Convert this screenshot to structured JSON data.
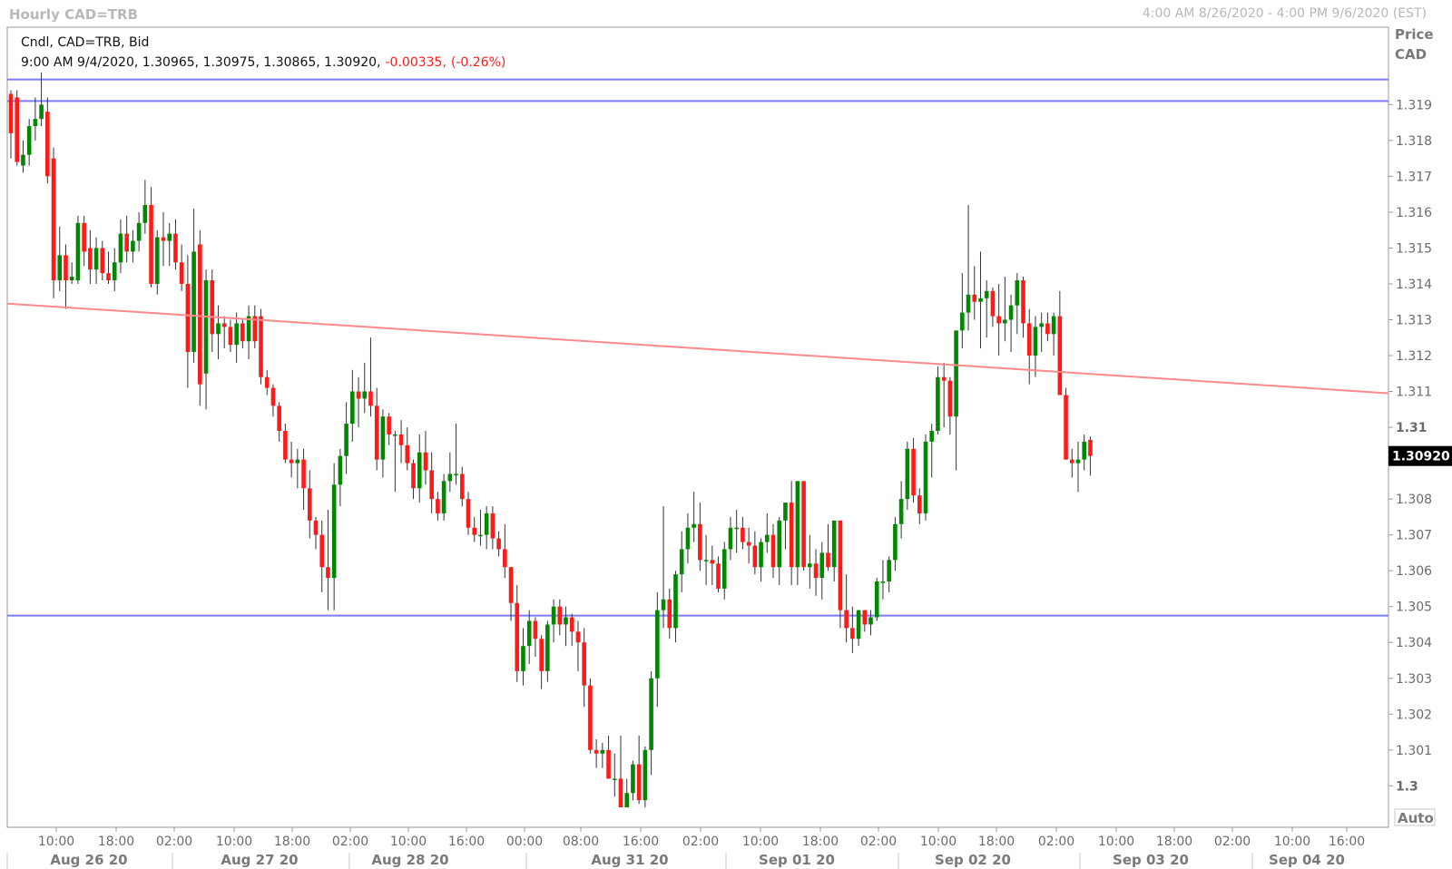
{
  "window": {
    "title": "Hourly CAD=TRB",
    "range": "4:00 AM 8/26/2020 - 4:00 PM 9/6/2020 (EST)"
  },
  "legend": {
    "series_label": "Cndl, CAD=TRB, Bid",
    "ohlc_text": "9:00 AM 9/4/2020, 1.30965, 1.30975, 1.30865, 1.30920,",
    "change": "-0.00335,",
    "change_pct": "(-0.26%)"
  },
  "price_axis": {
    "header": [
      "Price",
      "CAD"
    ],
    "current_label": "1.30920",
    "auto_label": "Auto"
  },
  "colors": {
    "up": "#008800",
    "down": "#ff1a1a",
    "hline": "#7b7bff",
    "trendline": "#ff8a8a",
    "current_tag": "#000000"
  },
  "chart_data": {
    "type": "candlestick",
    "title": "Hourly CAD=TRB",
    "series_name": "Cndl, CAD=TRB, Bid",
    "ylim": [
      1.2993,
      1.3204
    ],
    "yticks": [
      1.3,
      1.301,
      1.302,
      1.303,
      1.304,
      1.305,
      1.306,
      1.307,
      1.308,
      1.309,
      1.31,
      1.311,
      1.312,
      1.313,
      1.314,
      1.315,
      1.316,
      1.317,
      1.318,
      1.319
    ],
    "ytick_labels": [
      "1.3",
      "1.301",
      "1.302",
      "1.303",
      "1.304",
      "1.305",
      "1.306",
      "1.307",
      "1.308",
      "1.309",
      "1.31",
      "1.311",
      "1.312",
      "1.313",
      "1.314",
      "1.315",
      "1.316",
      "1.317",
      "1.318",
      "1.319"
    ],
    "bold_ticks": [
      "1.3",
      "1.31"
    ],
    "hidden_ticks": [
      "1.309"
    ],
    "time_labels": [
      "10:00",
      "18:00",
      "02:00",
      "10:00",
      "18:00",
      "02:00",
      "10:00",
      "16:00",
      "00:00",
      "08:00",
      "16:00",
      "02:00",
      "10:00",
      "18:00",
      "02:00",
      "10:00",
      "18:00",
      "02:00",
      "10:00",
      "18:00",
      "02:00",
      "10:00",
      "16:00"
    ],
    "date_labels": [
      "Aug 26 20",
      "Aug 27 20",
      "Aug 28 20",
      "Aug 31 20",
      "Sep 01 20",
      "Sep 02 20",
      "Sep 03 20",
      "Sep 04 20"
    ],
    "horizontal_lines": [
      1.3197,
      1.3191,
      1.30475
    ],
    "trendline": {
      "from": 1.31345,
      "to": 1.31095
    },
    "last_price": 1.3092,
    "candles": [
      [
        1.3193,
        1.3194,
        1.3175,
        1.3182
      ],
      [
        1.3192,
        1.3194,
        1.3173,
        1.3174
      ],
      [
        1.3173,
        1.318,
        1.3171,
        1.3176
      ],
      [
        1.3176,
        1.3186,
        1.3173,
        1.3184
      ],
      [
        1.3184,
        1.3192,
        1.318,
        1.3186
      ],
      [
        1.3186,
        1.3199,
        1.3184,
        1.319
      ],
      [
        1.3188,
        1.3192,
        1.3168,
        1.317
      ],
      [
        1.3175,
        1.3178,
        1.3136,
        1.3141
      ],
      [
        1.3141,
        1.3156,
        1.3138,
        1.3148
      ],
      [
        1.3148,
        1.3151,
        1.3133,
        1.3141
      ],
      [
        1.3141,
        1.3146,
        1.314,
        1.3142
      ],
      [
        1.3141,
        1.3159,
        1.314,
        1.3157
      ],
      [
        1.3157,
        1.3159,
        1.3145,
        1.3149
      ],
      [
        1.315,
        1.3155,
        1.314,
        1.3144
      ],
      [
        1.3144,
        1.3153,
        1.314,
        1.315
      ],
      [
        1.315,
        1.3152,
        1.3141,
        1.3143
      ],
      [
        1.3143,
        1.3149,
        1.314,
        1.3141
      ],
      [
        1.3141,
        1.315,
        1.3138,
        1.3146
      ],
      [
        1.3146,
        1.3158,
        1.3143,
        1.3154
      ],
      [
        1.3154,
        1.3159,
        1.3146,
        1.3149
      ],
      [
        1.3149,
        1.3155,
        1.3146,
        1.3152
      ],
      [
        1.3152,
        1.316,
        1.3149,
        1.3157
      ],
      [
        1.3157,
        1.3169,
        1.3154,
        1.3162
      ],
      [
        1.3162,
        1.3167,
        1.3139,
        1.314
      ],
      [
        1.314,
        1.3155,
        1.3137,
        1.3153
      ],
      [
        1.3153,
        1.316,
        1.3145,
        1.3152
      ],
      [
        1.3152,
        1.3157,
        1.3145,
        1.3154
      ],
      [
        1.3154,
        1.3158,
        1.3144,
        1.3146
      ],
      [
        1.3146,
        1.3151,
        1.3138,
        1.314
      ],
      [
        1.314,
        1.3148,
        1.3111,
        1.3121
      ],
      [
        1.3121,
        1.3161,
        1.3118,
        1.3149
      ],
      [
        1.3151,
        1.3155,
        1.3106,
        1.3112
      ],
      [
        1.3115,
        1.3144,
        1.3105,
        1.3141
      ],
      [
        1.3141,
        1.3144,
        1.3121,
        1.3126
      ],
      [
        1.3126,
        1.3134,
        1.3119,
        1.3129
      ],
      [
        1.3129,
        1.3131,
        1.3122,
        1.3128
      ],
      [
        1.3128,
        1.313,
        1.3121,
        1.3123
      ],
      [
        1.3123,
        1.3132,
        1.3118,
        1.3129
      ],
      [
        1.3129,
        1.313,
        1.3122,
        1.3124
      ],
      [
        1.3124,
        1.3134,
        1.3119,
        1.3131
      ],
      [
        1.3131,
        1.3134,
        1.3122,
        1.3124
      ],
      [
        1.3131,
        1.3133,
        1.3112,
        1.3114
      ],
      [
        1.3114,
        1.3116,
        1.3109,
        1.3111
      ],
      [
        1.3111,
        1.3112,
        1.3103,
        1.3106
      ],
      [
        1.3106,
        1.3107,
        1.3096,
        1.3099
      ],
      [
        1.3099,
        1.3101,
        1.309,
        1.3091
      ],
      [
        1.3091,
        1.3096,
        1.3086,
        1.309
      ],
      [
        1.309,
        1.3094,
        1.3083,
        1.3091
      ],
      [
        1.3091,
        1.3094,
        1.3077,
        1.3083
      ],
      [
        1.3083,
        1.3088,
        1.3069,
        1.3074
      ],
      [
        1.3074,
        1.3075,
        1.3066,
        1.307
      ],
      [
        1.307,
        1.3074,
        1.3054,
        1.3061
      ],
      [
        1.3061,
        1.3077,
        1.3049,
        1.3058
      ],
      [
        1.3058,
        1.309,
        1.3049,
        1.3084
      ],
      [
        1.3084,
        1.3094,
        1.3078,
        1.3092
      ],
      [
        1.3092,
        1.3107,
        1.3087,
        1.3101
      ],
      [
        1.3101,
        1.3116,
        1.3096,
        1.311
      ],
      [
        1.311,
        1.3114,
        1.31,
        1.3108
      ],
      [
        1.3108,
        1.3118,
        1.3104,
        1.311
      ],
      [
        1.311,
        1.3125,
        1.3103,
        1.3106
      ],
      [
        1.3106,
        1.3111,
        1.3088,
        1.3091
      ],
      [
        1.3091,
        1.3105,
        1.3086,
        1.3103
      ],
      [
        1.3103,
        1.3104,
        1.3095,
        1.3098
      ],
      [
        1.3098,
        1.3099,
        1.3082,
        1.3098
      ],
      [
        1.3098,
        1.3102,
        1.309,
        1.3095
      ],
      [
        1.3095,
        1.31,
        1.3088,
        1.309
      ],
      [
        1.309,
        1.3091,
        1.308,
        1.3083
      ],
      [
        1.3083,
        1.3098,
        1.3079,
        1.3093
      ],
      [
        1.3093,
        1.3099,
        1.3084,
        1.3088
      ],
      [
        1.3088,
        1.3093,
        1.3076,
        1.308
      ],
      [
        1.308,
        1.3082,
        1.3074,
        1.3076
      ],
      [
        1.3076,
        1.3087,
        1.3074,
        1.3085
      ],
      [
        1.3085,
        1.3093,
        1.3082,
        1.3087
      ],
      [
        1.3087,
        1.3101,
        1.3084,
        1.3087
      ],
      [
        1.3087,
        1.3089,
        1.3078,
        1.308
      ],
      [
        1.308,
        1.3082,
        1.307,
        1.3072
      ],
      [
        1.3072,
        1.3075,
        1.3068,
        1.307
      ],
      [
        1.307,
        1.3077,
        1.3067,
        1.307
      ],
      [
        1.307,
        1.3078,
        1.3066,
        1.3076
      ],
      [
        1.3076,
        1.3078,
        1.3066,
        1.3069
      ],
      [
        1.3069,
        1.3071,
        1.3064,
        1.3066
      ],
      [
        1.3066,
        1.3073,
        1.3058,
        1.3061
      ],
      [
        1.3061,
        1.3061,
        1.3046,
        1.3051
      ],
      [
        1.3051,
        1.3056,
        1.3029,
        1.3032
      ],
      [
        1.3032,
        1.3044,
        1.3028,
        1.3039
      ],
      [
        1.3039,
        1.3049,
        1.3034,
        1.3046
      ],
      [
        1.3046,
        1.3047,
        1.3036,
        1.3041
      ],
      [
        1.3041,
        1.3042,
        1.3027,
        1.3032
      ],
      [
        1.3032,
        1.3046,
        1.3029,
        1.3045
      ],
      [
        1.3045,
        1.3052,
        1.304,
        1.305
      ],
      [
        1.305,
        1.3052,
        1.3042,
        1.3045
      ],
      [
        1.3045,
        1.305,
        1.3039,
        1.3047
      ],
      [
        1.3047,
        1.3048,
        1.3039,
        1.3043
      ],
      [
        1.3043,
        1.3046,
        1.3032,
        1.304
      ],
      [
        1.304,
        1.3044,
        1.3022,
        1.3028
      ],
      [
        1.3028,
        1.303,
        1.3009,
        1.301
      ],
      [
        1.301,
        1.3013,
        1.3005,
        1.3009
      ],
      [
        1.3009,
        1.3012,
        1.3005,
        1.301
      ],
      [
        1.301,
        1.3014,
        1.3002,
        1.3002
      ],
      [
        1.3002,
        1.3009,
        1.2997,
        1.3002
      ],
      [
        1.3002,
        1.3014,
        1.2995,
        1.2994
      ],
      [
        1.2994,
        1.3002,
        1.2996,
        1.2998
      ],
      [
        1.2998,
        1.3007,
        1.2996,
        1.3006
      ],
      [
        1.3006,
        1.3014,
        1.2995,
        1.2996
      ],
      [
        1.2996,
        1.3011,
        1.2994,
        1.301
      ],
      [
        1.301,
        1.3032,
        1.3003,
        1.303
      ],
      [
        1.303,
        1.3054,
        1.3022,
        1.3049
      ],
      [
        1.3049,
        1.3078,
        1.3044,
        1.3052
      ],
      [
        1.3052,
        1.3055,
        1.3041,
        1.3044
      ],
      [
        1.3044,
        1.306,
        1.304,
        1.3059
      ],
      [
        1.3059,
        1.3071,
        1.3054,
        1.3066
      ],
      [
        1.3066,
        1.3076,
        1.3062,
        1.3072
      ],
      [
        1.3072,
        1.3082,
        1.3068,
        1.3073
      ],
      [
        1.3073,
        1.3079,
        1.306,
        1.3063
      ],
      [
        1.3063,
        1.307,
        1.3056,
        1.3063
      ],
      [
        1.3063,
        1.3067,
        1.3056,
        1.3062
      ],
      [
        1.3062,
        1.3064,
        1.3054,
        1.3055
      ],
      [
        1.3055,
        1.3068,
        1.3052,
        1.3066
      ],
      [
        1.3066,
        1.3075,
        1.3063,
        1.3072
      ],
      [
        1.3072,
        1.3077,
        1.3065,
        1.3072
      ],
      [
        1.3072,
        1.3075,
        1.3066,
        1.3068
      ],
      [
        1.3068,
        1.3072,
        1.3062,
        1.3067
      ],
      [
        1.3067,
        1.3071,
        1.3059,
        1.3061
      ],
      [
        1.3061,
        1.3069,
        1.3057,
        1.3068
      ],
      [
        1.3068,
        1.3076,
        1.3065,
        1.307
      ],
      [
        1.307,
        1.3073,
        1.3058,
        1.3061
      ],
      [
        1.3061,
        1.3075,
        1.3056,
        1.3074
      ],
      [
        1.3074,
        1.3079,
        1.3066,
        1.3079
      ],
      [
        1.3079,
        1.3085,
        1.3056,
        1.3061
      ],
      [
        1.3061,
        1.3079,
        1.3056,
        1.3085
      ],
      [
        1.3085,
        1.3083,
        1.306,
        1.3061
      ],
      [
        1.3061,
        1.307,
        1.3055,
        1.3062
      ],
      [
        1.3062,
        1.3066,
        1.3053,
        1.3058
      ],
      [
        1.3058,
        1.3068,
        1.3052,
        1.3065
      ],
      [
        1.3065,
        1.3073,
        1.306,
        1.3061
      ],
      [
        1.3061,
        1.3074,
        1.3057,
        1.3074
      ],
      [
        1.3074,
        1.3073,
        1.3044,
        1.3049
      ],
      [
        1.3049,
        1.3059,
        1.304,
        1.3044
      ],
      [
        1.3044,
        1.305,
        1.3037,
        1.3041
      ],
      [
        1.3041,
        1.3049,
        1.3039,
        1.3049
      ],
      [
        1.3049,
        1.3048,
        1.3043,
        1.3045
      ],
      [
        1.3045,
        1.3049,
        1.3042,
        1.3047
      ],
      [
        1.3047,
        1.3058,
        1.3046,
        1.3057
      ],
      [
        1.3057,
        1.3063,
        1.3052,
        1.3057
      ],
      [
        1.3057,
        1.3064,
        1.3054,
        1.3063
      ],
      [
        1.3063,
        1.3075,
        1.306,
        1.3073
      ],
      [
        1.3073,
        1.3085,
        1.3069,
        1.308
      ],
      [
        1.308,
        1.3096,
        1.3077,
        1.3094
      ],
      [
        1.3094,
        1.3097,
        1.3079,
        1.3081
      ],
      [
        1.3081,
        1.3083,
        1.3073,
        1.3076
      ],
      [
        1.3076,
        1.3098,
        1.3074,
        1.3096
      ],
      [
        1.3096,
        1.3101,
        1.3086,
        1.3099
      ],
      [
        1.3099,
        1.3117,
        1.3098,
        1.3114
      ],
      [
        1.3114,
        1.3118,
        1.31,
        1.3113
      ],
      [
        1.3113,
        1.3114,
        1.3098,
        1.3103
      ],
      [
        1.3103,
        1.3117,
        1.3088,
        1.3127
      ],
      [
        1.3127,
        1.3143,
        1.3122,
        1.3132
      ],
      [
        1.3132,
        1.3162,
        1.3127,
        1.3137
      ],
      [
        1.3137,
        1.3145,
        1.313,
        1.3135
      ],
      [
        1.3135,
        1.3149,
        1.3122,
        1.3136
      ],
      [
        1.3136,
        1.3141,
        1.3125,
        1.3138
      ],
      [
        1.3138,
        1.3139,
        1.3128,
        1.3131
      ],
      [
        1.3131,
        1.314,
        1.312,
        1.3129
      ],
      [
        1.3129,
        1.3142,
        1.3124,
        1.313
      ],
      [
        1.313,
        1.3137,
        1.3121,
        1.3134
      ],
      [
        1.3134,
        1.3143,
        1.3126,
        1.3141
      ],
      [
        1.3141,
        1.3142,
        1.3125,
        1.3129
      ],
      [
        1.3129,
        1.3133,
        1.3112,
        1.312
      ],
      [
        1.312,
        1.3131,
        1.3114,
        1.3128
      ],
      [
        1.3128,
        1.3132,
        1.3121,
        1.3129
      ],
      [
        1.3129,
        1.3132,
        1.3124,
        1.3126
      ],
      [
        1.3126,
        1.3132,
        1.312,
        1.3131
      ],
      [
        1.3131,
        1.3138,
        1.3117,
        1.3109
      ],
      [
        1.3109,
        1.3111,
        1.3095,
        1.3091
      ],
      [
        1.3091,
        1.3094,
        1.3086,
        1.309
      ],
      [
        1.309,
        1.3096,
        1.3082,
        1.3091
      ],
      [
        1.3091,
        1.3098,
        1.3088,
        1.3096
      ],
      [
        1.30965,
        1.30975,
        1.30865,
        1.3092
      ]
    ]
  }
}
